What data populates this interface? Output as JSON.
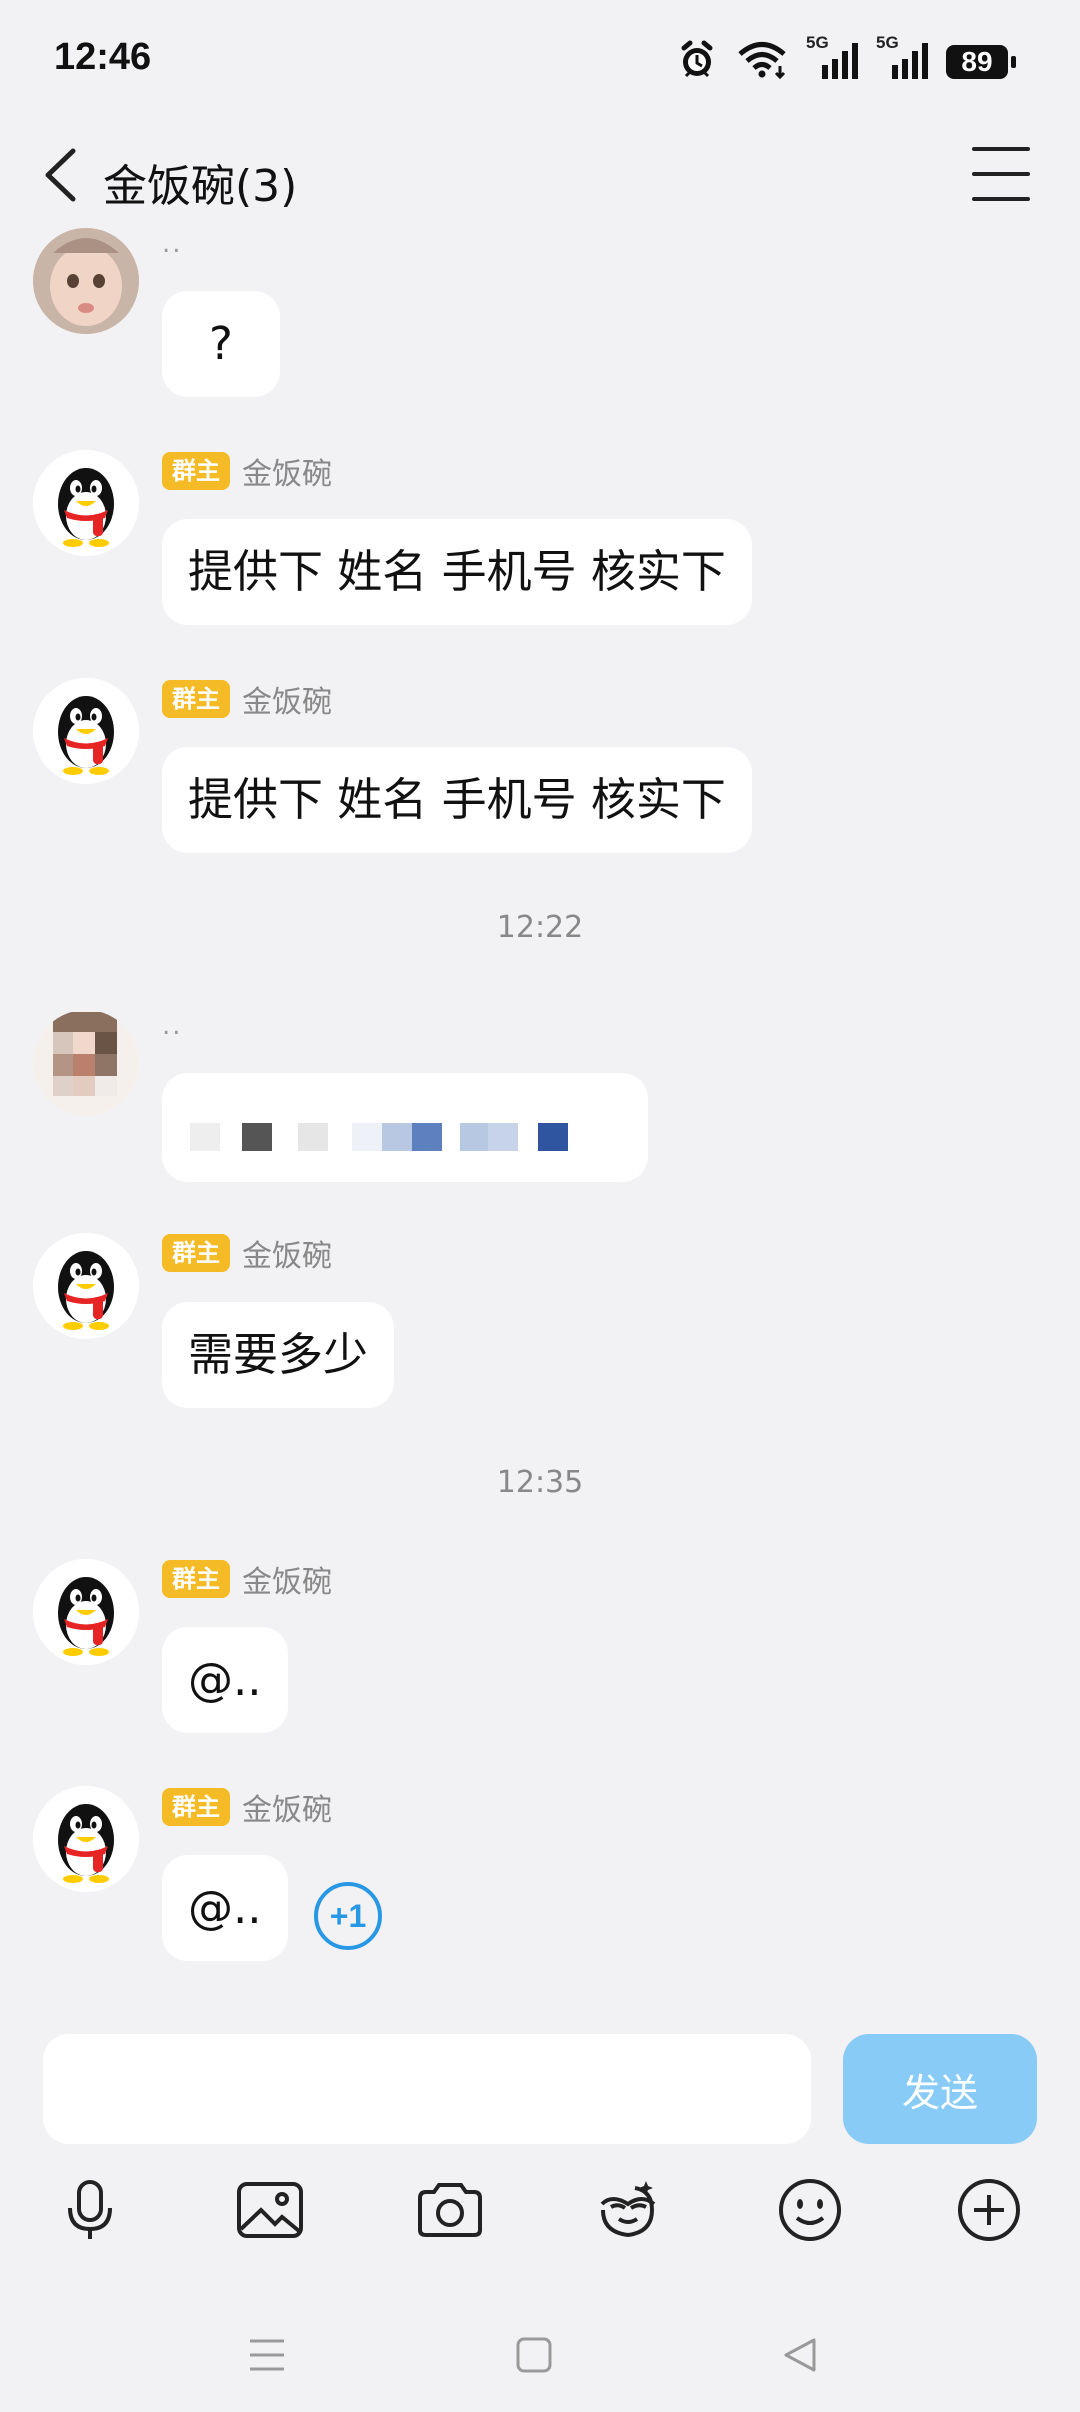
{
  "status_bar": {
    "time": "12:46",
    "network1": "5G",
    "network2": "5G",
    "battery": "89"
  },
  "header": {
    "title": "金饭碗(3)"
  },
  "messages": [
    {
      "sender": "..",
      "text": "?"
    },
    {
      "badge": "群主",
      "sender": "金饭碗",
      "text": "提供下 姓名  手机号  核实下"
    },
    {
      "badge": "群主",
      "sender": "金饭碗",
      "text": "提供下 姓名  手机号  核实下"
    },
    {
      "timestamp": "12:22"
    },
    {
      "sender": ".."
    },
    {
      "badge": "群主",
      "sender": "金饭碗",
      "text": "需要多少"
    },
    {
      "timestamp": "12:35"
    },
    {
      "badge": "群主",
      "sender": "金饭碗",
      "text": "@.."
    },
    {
      "badge": "群主",
      "sender": "金饭碗",
      "text": "@..",
      "reaction": "+1"
    }
  ],
  "composer": {
    "input_value": "",
    "send_label": "发送"
  },
  "colors": {
    "background": "#f2f2f5",
    "owner_badge": "#f5bb27",
    "send_button": "#89cbf7",
    "plus_one": "#2998e4"
  },
  "icons": {
    "toolbar": [
      "microphone-icon",
      "image-icon",
      "camera-icon",
      "magic-face-icon",
      "emoji-icon",
      "plus-icon"
    ],
    "navigation": [
      "menu-nav-icon",
      "home-nav-icon",
      "back-nav-icon"
    ]
  }
}
